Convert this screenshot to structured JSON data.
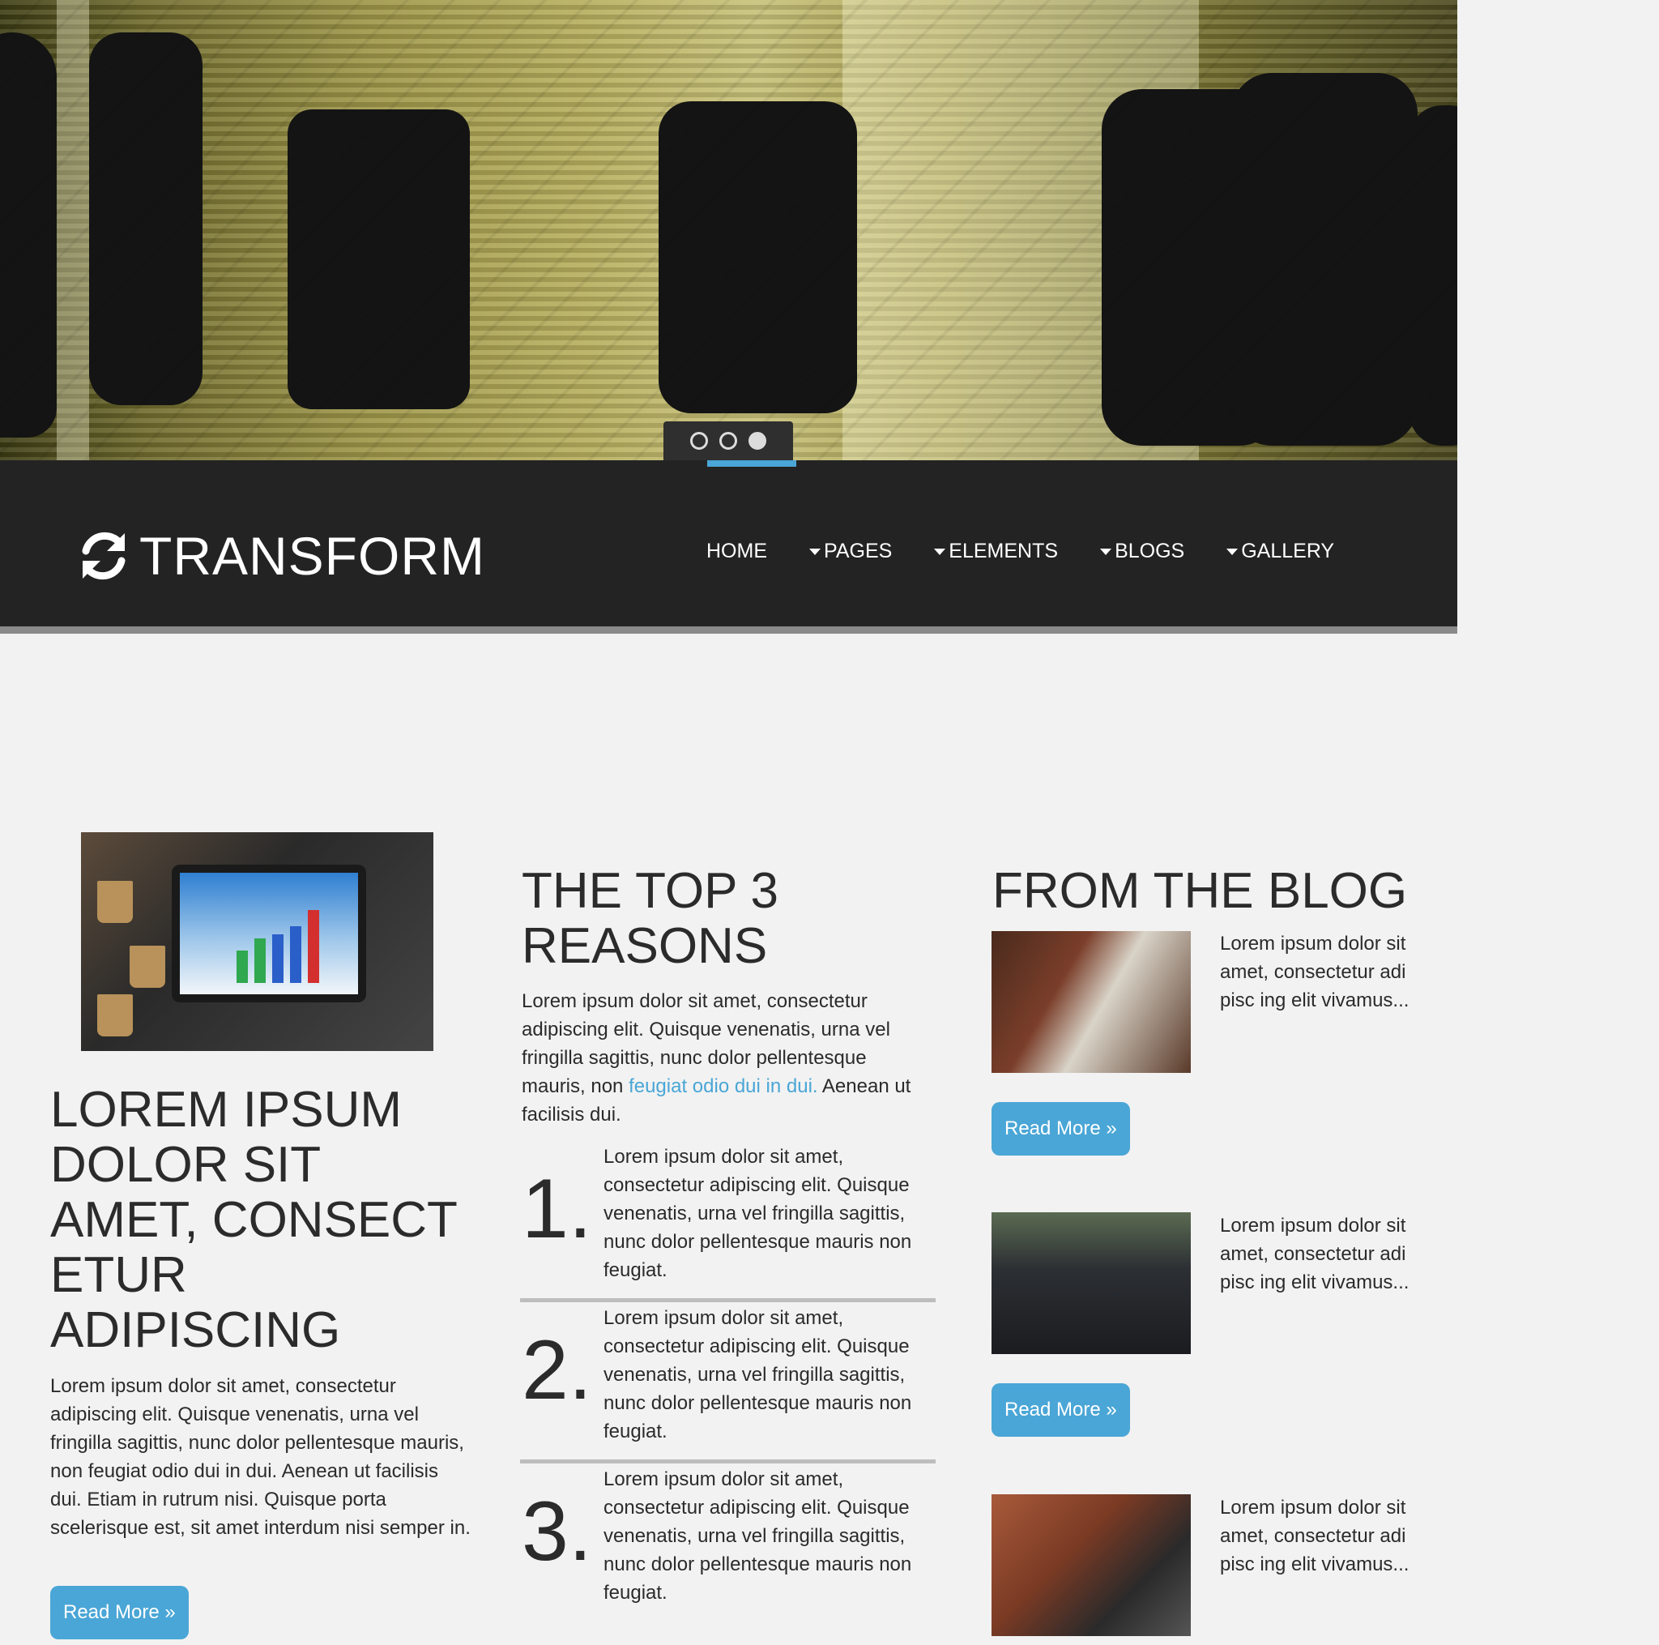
{
  "slider": {
    "dots": [
      {
        "active": false
      },
      {
        "active": false
      },
      {
        "active": true
      }
    ],
    "accent_color": "#4aa6d6"
  },
  "header": {
    "logo_text": "TRANSFORM",
    "logo_icon": "refresh-icon",
    "nav": [
      {
        "label": "HOME",
        "dropdown": false
      },
      {
        "label": "PAGES",
        "dropdown": true
      },
      {
        "label": "ELEMENTS",
        "dropdown": true
      },
      {
        "label": "BLOGS",
        "dropdown": true
      },
      {
        "label": "GALLERY",
        "dropdown": true
      }
    ]
  },
  "feature": {
    "title": "LOREM IPSUM DOLOR SIT AMET, CONSECT ETUR ADIPISCING",
    "text": "Lorem ipsum dolor sit amet, consectetur adipiscing elit. Quisque venenatis, urna vel fringilla sagittis, nunc dolor pellentesque mauris, non feugiat odio dui in dui. Aenean ut facilisis dui. Etiam in rutrum nisi. Quisque porta scelerisque est, sit amet interdum nisi semper in.",
    "button": "Read More »"
  },
  "reasons": {
    "title": "THE TOP 3 REASONS",
    "intro_before": "Lorem ipsum dolor sit amet, consectetur adipiscing elit. Quisque venenatis, urna vel fringilla sagittis, nunc dolor pellentesque mauris, non ",
    "intro_link": "feugiat odio dui in dui.",
    "intro_after": " Aenean ut facilisis dui.",
    "items": [
      {
        "num": "1.",
        "text": "Lorem ipsum dolor sit amet, consectetur adipiscing elit. Quisque venenatis, urna vel fringilla sagittis, nunc dolor pellentesque mauris non feugiat."
      },
      {
        "num": "2.",
        "text": "Lorem ipsum dolor sit amet, consectetur adipiscing elit. Quisque venenatis, urna vel fringilla sagittis, nunc dolor pellentesque mauris non feugiat."
      },
      {
        "num": "3.",
        "text": "Lorem ipsum dolor sit amet, consectetur adipiscing elit. Quisque venenatis, urna vel fringilla sagittis, nunc dolor pellentesque mauris non feugiat."
      }
    ]
  },
  "blog": {
    "title": "FROM THE BLOG",
    "posts": [
      {
        "excerpt": "Lorem ipsum dolor sit amet, consectetur adi pisc ing elit vivamus...",
        "button": "Read More »"
      },
      {
        "excerpt": "Lorem ipsum dolor sit amet, consectetur adi pisc ing elit vivamus...",
        "button": "Read More »"
      },
      {
        "excerpt": "Lorem ipsum dolor sit amet, consectetur adi pisc ing elit vivamus..."
      }
    ]
  }
}
